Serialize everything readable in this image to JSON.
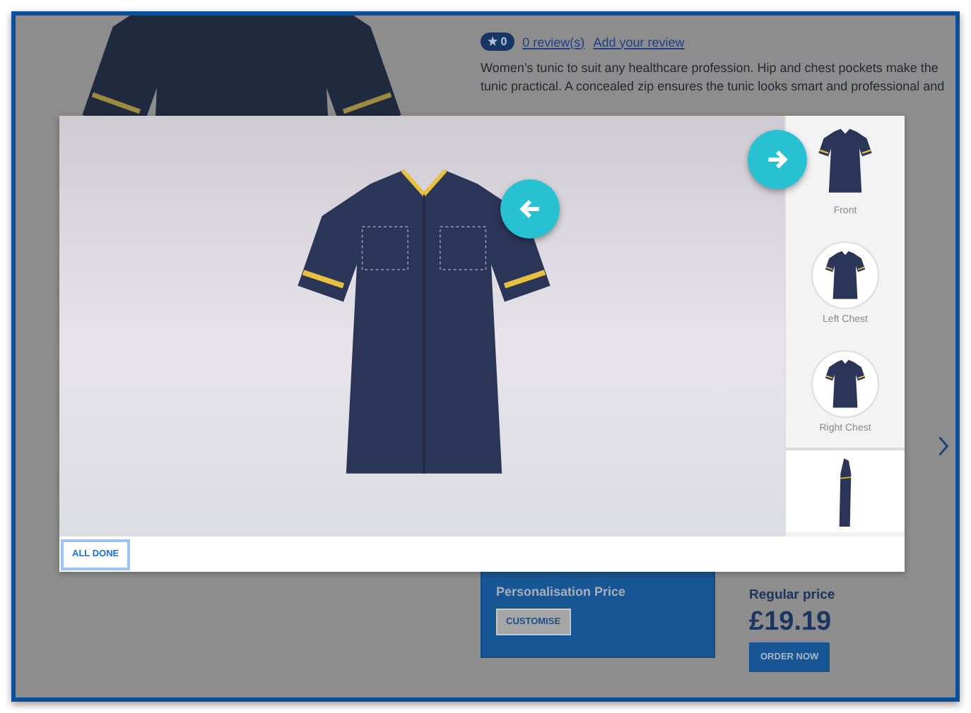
{
  "product": {
    "rating_badge": {
      "icon": "★",
      "count": "0"
    },
    "reviews_link": "0 review(s)",
    "add_review_link": "Add your review",
    "description": "Women’s tunic to suit any healthcare profession. Hip and chest pockets make the tunic practical. A concealed zip ensures the tunic looks smart and professional and"
  },
  "personalisation": {
    "title": "Personalisation Price",
    "button": "CUSTOMISE"
  },
  "regular": {
    "title": "Regular price",
    "price": "£19.19",
    "button": "ORDER NOW"
  },
  "modal": {
    "thumbnails": [
      {
        "kind": "plain",
        "label": "Front"
      },
      {
        "kind": "circle",
        "label": "Left Chest"
      },
      {
        "kind": "circle",
        "label": "Right Chest"
      },
      {
        "kind": "side"
      }
    ],
    "done_button": "ALL DONE"
  }
}
